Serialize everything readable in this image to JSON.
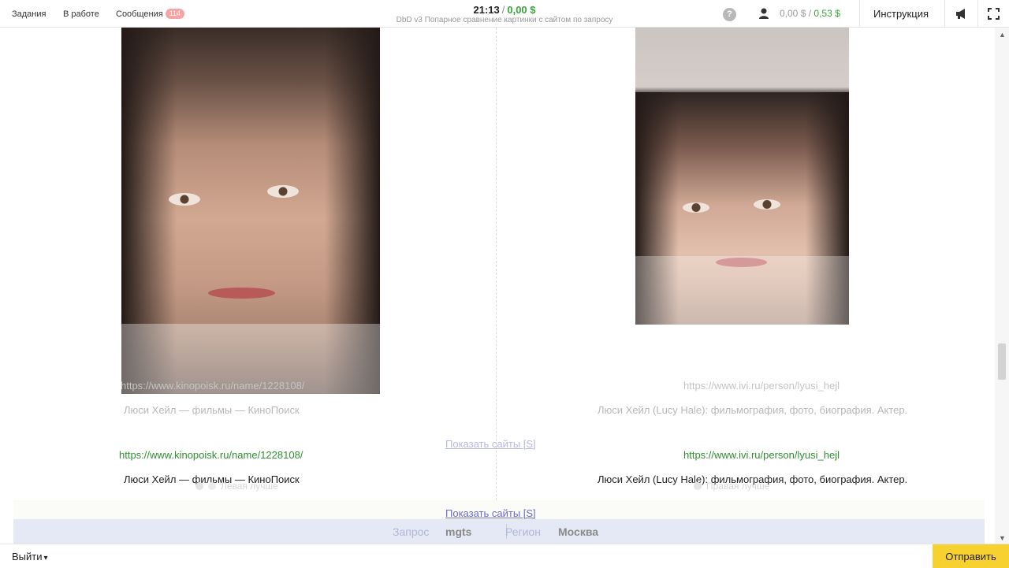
{
  "nav": {
    "tasks": "Задания",
    "in_work": "В работе",
    "messages": "Сообщения",
    "messages_count": "114"
  },
  "header": {
    "timer": "21:13",
    "separator": "/",
    "earned": "0,00 $",
    "task_name": "DbD v3 Попарное сравнение картинки с сайтом по запросу"
  },
  "balance": {
    "pending": "0,00 $",
    "separator": "/",
    "available": "0,53 $"
  },
  "instructions_label": "Инструкция",
  "icons": {
    "help": "?",
    "help_name": "question-icon",
    "user_name": "user-download-icon",
    "announce_name": "megaphone-icon",
    "fullscreen_name": "fullscreen-icon"
  },
  "left": {
    "url_faded": "https://www.kinopoisk.ru/name/1228108/",
    "title_faded": "Люси Хейл — фильмы — КиноПоиск",
    "url": "https://www.kinopoisk.ru/name/1228108/",
    "title": "Люси Хейл — фильмы — КиноПоиск",
    "choice": "Левая лучше"
  },
  "right": {
    "url_faded": "https://www.ivi.ru/person/lyusi_hejl",
    "title_faded": "Люси Хейл (Lucy Hale): фильмография, фото, биография. Актер.",
    "url": "https://www.ivi.ru/person/lyusi_hejl",
    "title": "Люси Хейл (Lucy Hale): фильмография, фото, биография. Актер.",
    "choice": "Правая лучше"
  },
  "show_sites_faded": "Показать сайты [S]",
  "show_sites": "Показать сайты [S]",
  "query": {
    "label": "Запрос",
    "value": "mgts",
    "region_label": "Регион",
    "region_value": "Москва"
  },
  "footer": {
    "logout": "Выйти",
    "submit": "Отправить"
  },
  "colors": {
    "accent_green": "#3aa53a",
    "link_purple": "#6b6bc9",
    "submit_yellow": "#f6d12f",
    "query_bar": "#e5e9f6"
  }
}
